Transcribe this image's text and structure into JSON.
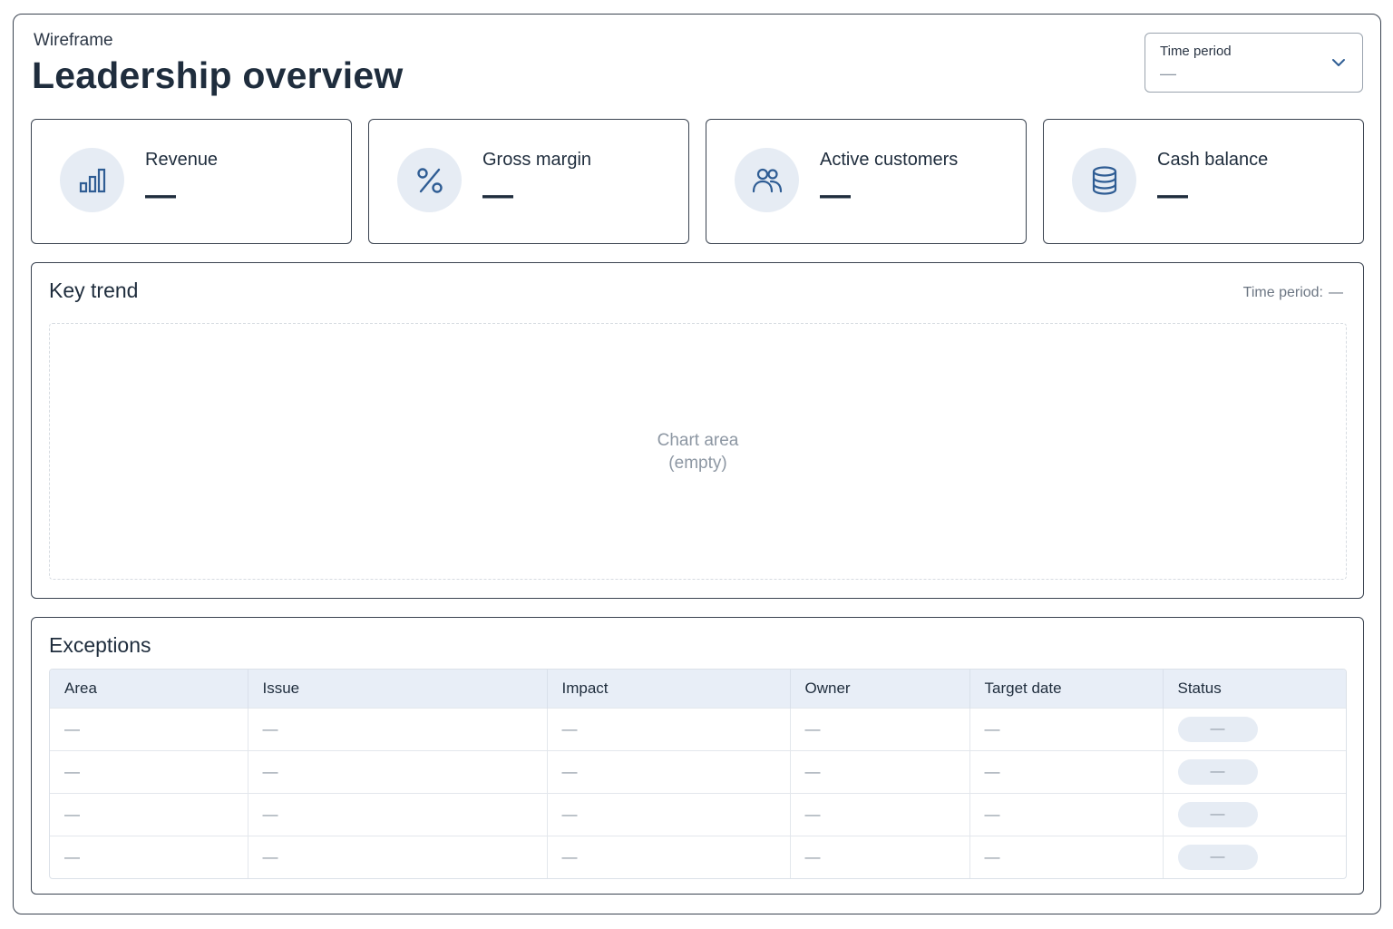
{
  "header": {
    "eyebrow": "Wireframe",
    "title": "Leadership overview"
  },
  "time_period_select": {
    "label": "Time period",
    "value": "—"
  },
  "kpis": [
    {
      "label": "Revenue",
      "value": "—",
      "icon": "bar-chart-icon"
    },
    {
      "label": "Gross margin",
      "value": "—",
      "icon": "percent-icon"
    },
    {
      "label": "Active customers",
      "value": "—",
      "icon": "users-icon"
    },
    {
      "label": "Cash balance",
      "value": "—",
      "icon": "database-icon"
    }
  ],
  "key_trend": {
    "title": "Key trend",
    "period_label": "Time period:",
    "period_value": "—",
    "placeholder_line1": "Chart area",
    "placeholder_line2": "(empty)"
  },
  "exceptions": {
    "title": "Exceptions",
    "columns": [
      "Area",
      "Issue",
      "Impact",
      "Owner",
      "Target date",
      "Status"
    ],
    "rows": [
      [
        "—",
        "—",
        "—",
        "—",
        "—",
        "—"
      ],
      [
        "—",
        "—",
        "—",
        "—",
        "—",
        "—"
      ],
      [
        "—",
        "—",
        "—",
        "—",
        "—",
        "—"
      ],
      [
        "—",
        "—",
        "—",
        "—",
        "—",
        "—"
      ]
    ]
  },
  "colors": {
    "icon_stroke": "#2f5d94",
    "icon_bg": "#e6ecf4",
    "table_header_bg": "#e8eef7",
    "border": "#3a4350"
  }
}
